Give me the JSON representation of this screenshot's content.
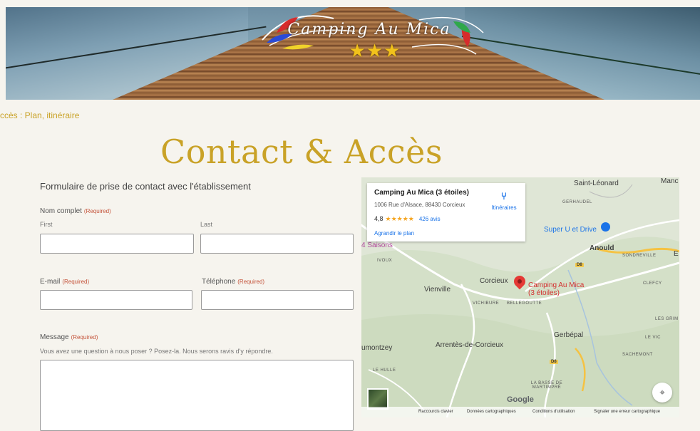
{
  "header": {
    "logo_text": "Camping Au Mica",
    "stars": "★★★"
  },
  "breadcrumb": "ccès : Plan, itinéraire",
  "page_title": "Contact & Accès",
  "form": {
    "heading": "Formulaire de prise de contact avec l'établissement",
    "required_label": "(Required)",
    "name": {
      "label": "Nom complet",
      "first": "First",
      "last": "Last"
    },
    "email": {
      "label": "E-mail"
    },
    "phone": {
      "label": "Téléphone"
    },
    "message": {
      "label": "Message",
      "description": "Vous avez une question à nous poser ? Posez-la. Nous serons ravis d'y répondre."
    }
  },
  "map": {
    "card": {
      "name": "Camping Au Mica (3 étoiles)",
      "address": "1006 Rue d'Alsace, 88430 Corcieux",
      "rating": "4,8",
      "rating_stars": "★★★★★",
      "reviews": "426 avis",
      "enlarge": "Agrandir le plan",
      "directions": "Itinéraires"
    },
    "places": {
      "saint_leonard": "Saint-Léonard",
      "manc": "Manc",
      "gerhaudel": "GERHAUDEL",
      "super_u": "Super U et Drive",
      "anould": "Anould",
      "sondreville": "SONDREVILLE",
      "e": "E",
      "saisons": "4 Saisons",
      "ivoux": "IVOUX",
      "vienville": "Vienville",
      "corcieux": "Corcieux",
      "camping_label": "Camping Au Mica (3 étoiles)",
      "vichibure": "VICHIBURE",
      "bellegoutte": "BELLEGOUTTE",
      "clefcy": "CLEFCY",
      "les_grim": "LES GRIM",
      "gerbepal": "Gerbépal",
      "le_vic": "LE VIC",
      "arrentes": "Arrentès-de-Corcieux",
      "montzey": "umontzey",
      "sachemont": "SACHEMONT",
      "le_hulle": "LE HULLE",
      "basse": "LA BASSE DE MARTIMPRÉ",
      "d8": "D8",
      "d8b": "D8"
    },
    "google": "Google",
    "footer": {
      "shortcuts": "Raccourcis clavier",
      "data": "Données cartographiques",
      "terms": "Conditions d'utilisation",
      "report": "Signaler une erreur cartographique"
    }
  }
}
